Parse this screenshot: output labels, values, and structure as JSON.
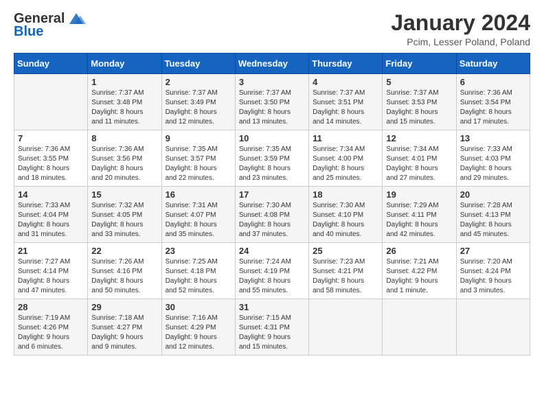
{
  "header": {
    "logo_general": "General",
    "logo_blue": "Blue",
    "month_title": "January 2024",
    "location": "Pcim, Lesser Poland, Poland"
  },
  "days_of_week": [
    "Sunday",
    "Monday",
    "Tuesday",
    "Wednesday",
    "Thursday",
    "Friday",
    "Saturday"
  ],
  "weeks": [
    [
      {
        "day": "",
        "info": ""
      },
      {
        "day": "1",
        "info": "Sunrise: 7:37 AM\nSunset: 3:48 PM\nDaylight: 8 hours\nand 11 minutes."
      },
      {
        "day": "2",
        "info": "Sunrise: 7:37 AM\nSunset: 3:49 PM\nDaylight: 8 hours\nand 12 minutes."
      },
      {
        "day": "3",
        "info": "Sunrise: 7:37 AM\nSunset: 3:50 PM\nDaylight: 8 hours\nand 13 minutes."
      },
      {
        "day": "4",
        "info": "Sunrise: 7:37 AM\nSunset: 3:51 PM\nDaylight: 8 hours\nand 14 minutes."
      },
      {
        "day": "5",
        "info": "Sunrise: 7:37 AM\nSunset: 3:53 PM\nDaylight: 8 hours\nand 15 minutes."
      },
      {
        "day": "6",
        "info": "Sunrise: 7:36 AM\nSunset: 3:54 PM\nDaylight: 8 hours\nand 17 minutes."
      }
    ],
    [
      {
        "day": "7",
        "info": "Sunrise: 7:36 AM\nSunset: 3:55 PM\nDaylight: 8 hours\nand 18 minutes."
      },
      {
        "day": "8",
        "info": "Sunrise: 7:36 AM\nSunset: 3:56 PM\nDaylight: 8 hours\nand 20 minutes."
      },
      {
        "day": "9",
        "info": "Sunrise: 7:35 AM\nSunset: 3:57 PM\nDaylight: 8 hours\nand 22 minutes."
      },
      {
        "day": "10",
        "info": "Sunrise: 7:35 AM\nSunset: 3:59 PM\nDaylight: 8 hours\nand 23 minutes."
      },
      {
        "day": "11",
        "info": "Sunrise: 7:34 AM\nSunset: 4:00 PM\nDaylight: 8 hours\nand 25 minutes."
      },
      {
        "day": "12",
        "info": "Sunrise: 7:34 AM\nSunset: 4:01 PM\nDaylight: 8 hours\nand 27 minutes."
      },
      {
        "day": "13",
        "info": "Sunrise: 7:33 AM\nSunset: 4:03 PM\nDaylight: 8 hours\nand 29 minutes."
      }
    ],
    [
      {
        "day": "14",
        "info": "Sunrise: 7:33 AM\nSunset: 4:04 PM\nDaylight: 8 hours\nand 31 minutes."
      },
      {
        "day": "15",
        "info": "Sunrise: 7:32 AM\nSunset: 4:05 PM\nDaylight: 8 hours\nand 33 minutes."
      },
      {
        "day": "16",
        "info": "Sunrise: 7:31 AM\nSunset: 4:07 PM\nDaylight: 8 hours\nand 35 minutes."
      },
      {
        "day": "17",
        "info": "Sunrise: 7:30 AM\nSunset: 4:08 PM\nDaylight: 8 hours\nand 37 minutes."
      },
      {
        "day": "18",
        "info": "Sunrise: 7:30 AM\nSunset: 4:10 PM\nDaylight: 8 hours\nand 40 minutes."
      },
      {
        "day": "19",
        "info": "Sunrise: 7:29 AM\nSunset: 4:11 PM\nDaylight: 8 hours\nand 42 minutes."
      },
      {
        "day": "20",
        "info": "Sunrise: 7:28 AM\nSunset: 4:13 PM\nDaylight: 8 hours\nand 45 minutes."
      }
    ],
    [
      {
        "day": "21",
        "info": "Sunrise: 7:27 AM\nSunset: 4:14 PM\nDaylight: 8 hours\nand 47 minutes."
      },
      {
        "day": "22",
        "info": "Sunrise: 7:26 AM\nSunset: 4:16 PM\nDaylight: 8 hours\nand 50 minutes."
      },
      {
        "day": "23",
        "info": "Sunrise: 7:25 AM\nSunset: 4:18 PM\nDaylight: 8 hours\nand 52 minutes."
      },
      {
        "day": "24",
        "info": "Sunrise: 7:24 AM\nSunset: 4:19 PM\nDaylight: 8 hours\nand 55 minutes."
      },
      {
        "day": "25",
        "info": "Sunrise: 7:23 AM\nSunset: 4:21 PM\nDaylight: 8 hours\nand 58 minutes."
      },
      {
        "day": "26",
        "info": "Sunrise: 7:21 AM\nSunset: 4:22 PM\nDaylight: 9 hours\nand 1 minute."
      },
      {
        "day": "27",
        "info": "Sunrise: 7:20 AM\nSunset: 4:24 PM\nDaylight: 9 hours\nand 3 minutes."
      }
    ],
    [
      {
        "day": "28",
        "info": "Sunrise: 7:19 AM\nSunset: 4:26 PM\nDaylight: 9 hours\nand 6 minutes."
      },
      {
        "day": "29",
        "info": "Sunrise: 7:18 AM\nSunset: 4:27 PM\nDaylight: 9 hours\nand 9 minutes."
      },
      {
        "day": "30",
        "info": "Sunrise: 7:16 AM\nSunset: 4:29 PM\nDaylight: 9 hours\nand 12 minutes."
      },
      {
        "day": "31",
        "info": "Sunrise: 7:15 AM\nSunset: 4:31 PM\nDaylight: 9 hours\nand 15 minutes."
      },
      {
        "day": "",
        "info": ""
      },
      {
        "day": "",
        "info": ""
      },
      {
        "day": "",
        "info": ""
      }
    ]
  ]
}
